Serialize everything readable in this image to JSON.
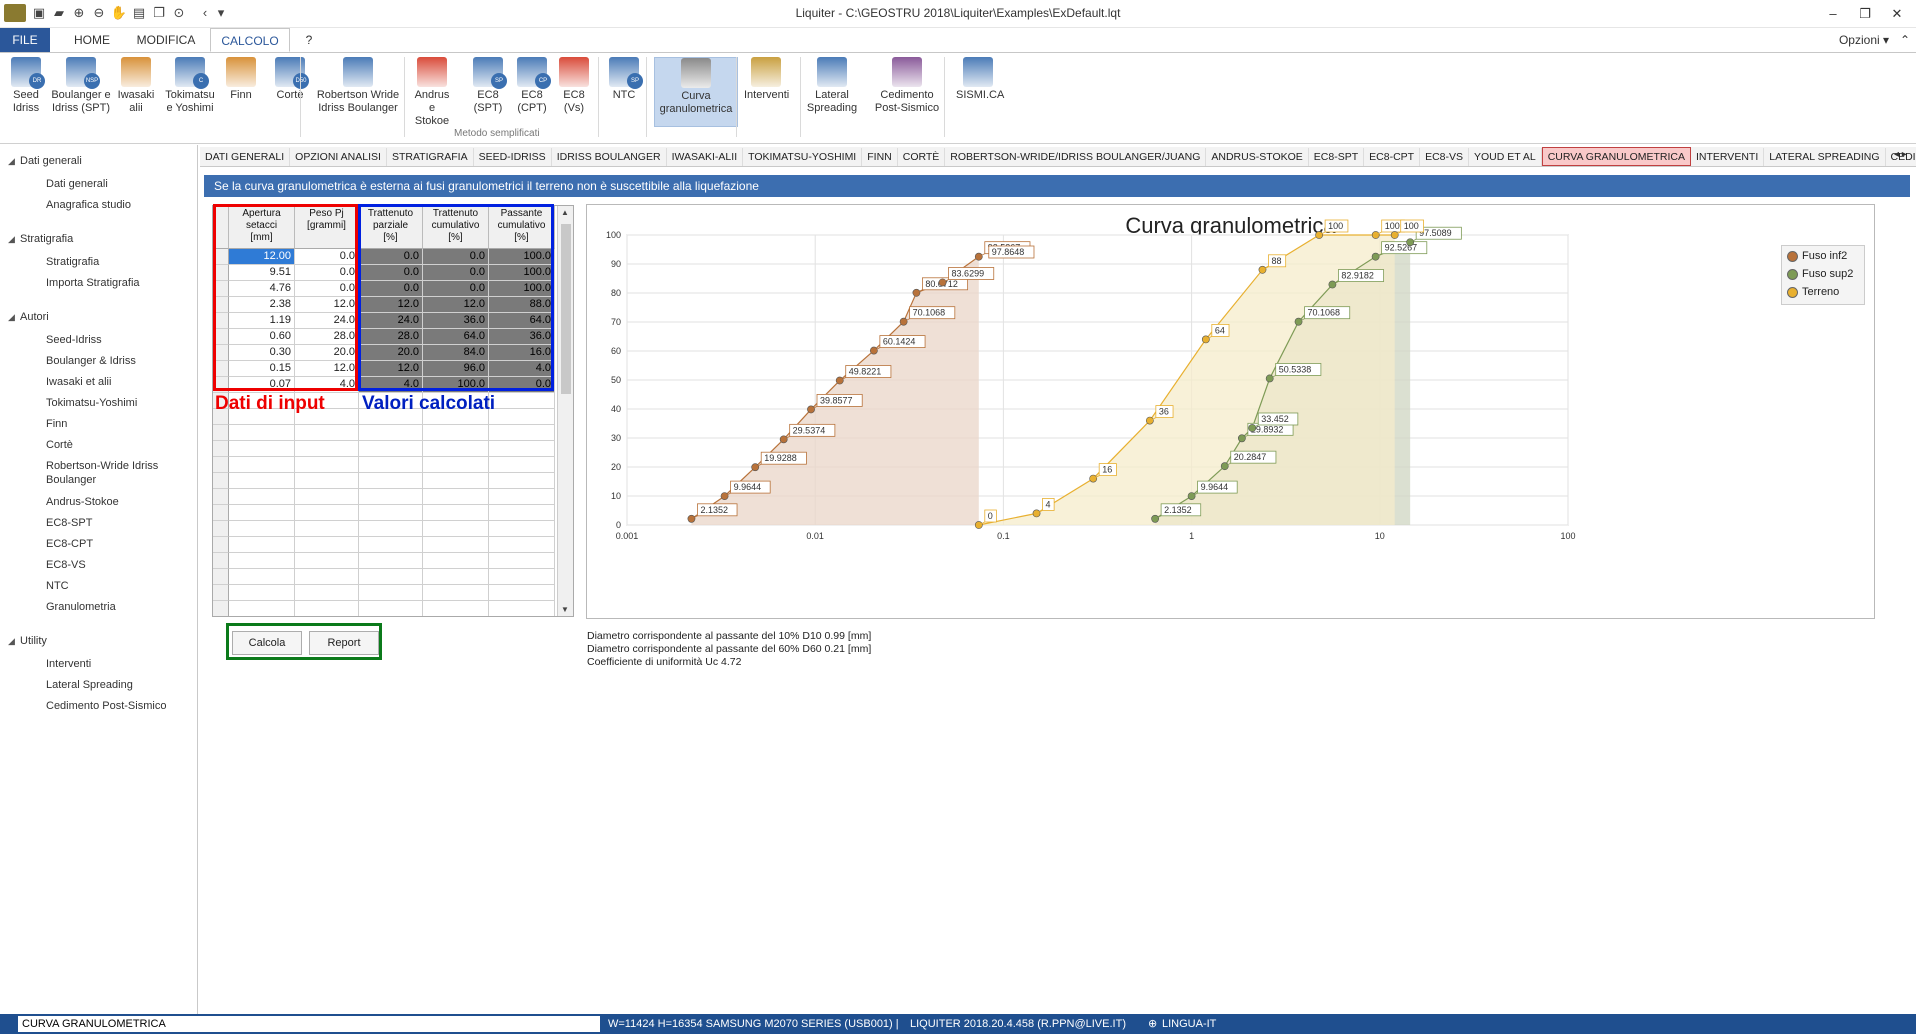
{
  "window": {
    "title": "Liquiter - C:\\GEOSTRU 2018\\Liquiter\\Examples\\ExDefault.lqt",
    "options_label": "Opzioni",
    "minimize": "‒",
    "restore": "❐",
    "close": "✕"
  },
  "menu": {
    "file": "FILE",
    "home": "HOME",
    "modifica": "MODIFICA",
    "calcolo": "CALCOLO",
    "help": "?"
  },
  "ribbon": {
    "buttons": [
      {
        "label": "Seed\nIdriss",
        "badge": "DR"
      },
      {
        "label": "Boulanger e\nIdriss (SPT)",
        "badge": "NSP"
      },
      {
        "label": "Iwasaki\nalii",
        "badge": ""
      },
      {
        "label": "Tokimatsu\ne Yoshimi",
        "badge": "C"
      },
      {
        "label": "Finn",
        "badge": ""
      },
      {
        "label": "Cortè",
        "badge": "D50"
      },
      {
        "label": "Robertson Wride\nIdriss Boulanger",
        "badge": ""
      },
      {
        "label": "Andrus e\nStokoe",
        "badge": ""
      },
      {
        "label": "EC8\n(SPT)",
        "badge": "SP"
      },
      {
        "label": "EC8\n(CPT)",
        "badge": "CP"
      },
      {
        "label": "EC8\n(Vs)",
        "badge": ""
      },
      {
        "label": "NTC",
        "badge": "SP"
      },
      {
        "label": "Curva\ngranulometrica",
        "badge": ""
      },
      {
        "label": "Interventi",
        "badge": ""
      },
      {
        "label": "Lateral\nSpreading",
        "badge": ""
      },
      {
        "label": "Cedimento\nPost-Sismico",
        "badge": ""
      },
      {
        "label": "SISMI.CA",
        "badge": ""
      }
    ],
    "group_label": "Metodo semplificati"
  },
  "sidebar": {
    "groups": [
      {
        "label": "Dati generali",
        "items": [
          "Dati generali",
          "Anagrafica studio"
        ]
      },
      {
        "label": "Stratigrafia",
        "items": [
          "Stratigrafia",
          "Importa Stratigrafia"
        ]
      },
      {
        "label": "Autori",
        "items": [
          "Seed-Idriss",
          "Boulanger & Idriss",
          "Iwasaki et alii",
          "Tokimatsu-Yoshimi",
          "Finn",
          "Cortè",
          "Robertson-Wride Idriss\nBoulanger",
          "Andrus-Stokoe",
          "EC8-SPT",
          "EC8-CPT",
          "EC8-VS",
          "NTC",
          "Granulometria"
        ]
      },
      {
        "label": "Utility",
        "items": [
          "Interventi",
          "Lateral Spreading",
          "Cedimento Post-Sismico"
        ]
      }
    ]
  },
  "doc_tabs": [
    "DATI GENERALI",
    "OPZIONI ANALISI",
    "STRATIGRAFIA",
    "SEED-IDRISS",
    "IDRISS BOULANGER",
    "IWASAKI-ALII",
    "TOKIMATSU-YOSHIMI",
    "FINN",
    "CORTÈ",
    "ROBERTSON-WRIDE/IDRISS BOULANGER/JUANG",
    "ANDRUS-STOKOE",
    "EC8-SPT",
    "EC8-CPT",
    "EC8-VS",
    "YOUD ET AL",
    "CURVA GRANULOMETRICA",
    "INTERVENTI",
    "LATERAL SPREADING",
    "CEDIME"
  ],
  "active_tab": "CURVA GRANULOMETRICA",
  "banner": "Se la curva granulometrica è esterna ai fusi granulometrici il terreno non è suscettibile alla liquefazione",
  "table": {
    "headers": [
      "Apertura\nsetacci\n[mm]",
      "Peso Pj\n[grammi]",
      "Trattenuto\nparziale\n[%]",
      "Trattenuto\ncumulativo\n[%]",
      "Passante\ncumulativo\n[%]"
    ],
    "rows": [
      [
        "12.00",
        "0.0",
        "0.0",
        "0.0",
        "100.0"
      ],
      [
        "9.51",
        "0.0",
        "0.0",
        "0.0",
        "100.0"
      ],
      [
        "4.76",
        "0.0",
        "0.0",
        "0.0",
        "100.0"
      ],
      [
        "2.38",
        "12.0",
        "12.0",
        "12.0",
        "88.0"
      ],
      [
        "1.19",
        "24.0",
        "24.0",
        "36.0",
        "64.0"
      ],
      [
        "0.60",
        "28.0",
        "28.0",
        "64.0",
        "36.0"
      ],
      [
        "0.30",
        "20.0",
        "20.0",
        "84.0",
        "16.0"
      ],
      [
        "0.15",
        "12.0",
        "12.0",
        "96.0",
        "4.0"
      ],
      [
        "0.07",
        "4.0",
        "4.0",
        "100.0",
        "0.0"
      ]
    ],
    "label_input": "Dati di input",
    "label_calc": "Valori calcolati"
  },
  "buttons": {
    "calcola": "Calcola",
    "report": "Report"
  },
  "chart_data": {
    "type": "line",
    "title": "Curva granulometrica",
    "x_scale": "log",
    "xlim": [
      0.001,
      100
    ],
    "ylim": [
      0,
      100
    ],
    "x_ticks": [
      "0.001",
      "0.01",
      "0.1",
      "1",
      "10",
      "100"
    ],
    "y_ticks": [
      "0",
      "10",
      "20",
      "30",
      "40",
      "50",
      "60",
      "70",
      "80",
      "90",
      "100"
    ],
    "legend_position": "top-right",
    "series": [
      {
        "name": "Fuso inf2",
        "color": "#b8723a",
        "fill": "#e9d6c8",
        "x": [
          0.0022,
          0.0033,
          0.0048,
          0.0068,
          0.0095,
          0.0135,
          0.0205,
          0.0295,
          0.0345,
          0.0475,
          0.074
        ],
        "y": [
          2.1352,
          9.9644,
          19.9288,
          29.5374,
          39.8577,
          49.8221,
          60.1424,
          70.1068,
          80.0712,
          83.6299,
          92.5267
        ],
        "labels": [
          "2.1352",
          "9.9644",
          "19.9288",
          "29.5374",
          "39.8577",
          "49.8221",
          "60.1424",
          "70.1068",
          "80.0712",
          "83.6299",
          "92.5267"
        ],
        "extra_label": "97.8648"
      },
      {
        "name": "Fuso sup2",
        "color": "#7e9b56",
        "fill": "#cfd6c2",
        "x": [
          0.64,
          1.0,
          1.5,
          1.85,
          2.1,
          2.6,
          3.7,
          5.6,
          9.5,
          14.5
        ],
        "y": [
          2.1352,
          9.9644,
          20.2847,
          29.8932,
          33.452,
          50.5338,
          70.1068,
          82.9182,
          92.5267,
          97.5089
        ],
        "labels": [
          "2.1352",
          "9.9644",
          "20.2847",
          "29.8932",
          "33.452",
          "50.5338",
          "70.1068",
          "82.9182",
          "92.5267",
          "97.5089"
        ]
      },
      {
        "name": "Terreno",
        "color": "#e8b030",
        "fill": "#f6eccb",
        "x": [
          0.074,
          0.15,
          0.3,
          0.6,
          1.19,
          2.38,
          4.76,
          9.51,
          12.0
        ],
        "y": [
          0,
          4,
          16,
          36,
          64,
          88,
          100,
          100,
          100
        ],
        "labels": [
          "0",
          "4",
          "16",
          "36",
          "64",
          "88",
          "100",
          "100",
          "100"
        ]
      }
    ]
  },
  "results": [
    "Diametro corrispondente al passante del 10% D10 0.99 [mm]",
    "Diametro corrispondente al passante del 60% D60 0.21 [mm]",
    "Coefficiente di uniformità Uc 4.72"
  ],
  "status": {
    "left": "CURVA GRANULOMETRICA",
    "printer": "W=11424 H=16354 SAMSUNG M2070 SERIES (USB001) |",
    "version": "LIQUITER 2018.20.4.458 (R.PPN@LIVE.IT)",
    "lingua": "LINGUA-IT"
  }
}
